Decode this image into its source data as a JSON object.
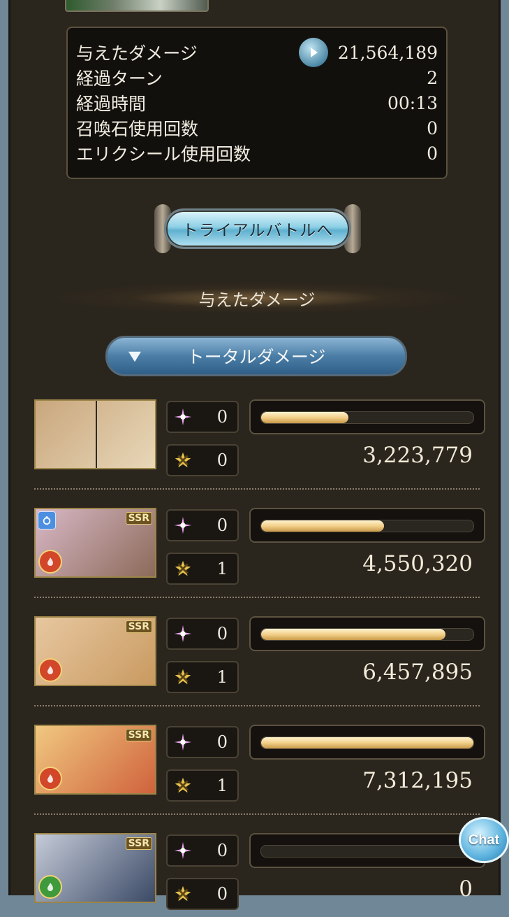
{
  "stats": {
    "rows": [
      {
        "label": "与えたダメージ",
        "value": "21,564,189"
      },
      {
        "label": "経過ターン",
        "value": "2"
      },
      {
        "label": "経過時間",
        "value": "00:13"
      },
      {
        "label": "召喚石使用回数",
        "value": "0"
      },
      {
        "label": "エリクシール使用回数",
        "value": "0"
      }
    ]
  },
  "trial_button": {
    "label": "トライアルバトルへ"
  },
  "section": {
    "title": "与えたダメージ"
  },
  "damage_select": {
    "label": "トータルダメージ"
  },
  "members": [
    {
      "ability_count": "0",
      "ca_count": "0",
      "bar_fraction": 0.41,
      "damage": "3,223,779",
      "ssr": "",
      "element": "",
      "portrait_colors": [
        "#c9a77d",
        "#e8d7b8"
      ]
    },
    {
      "ability_count": "0",
      "ca_count": "1",
      "bar_fraction": 0.58,
      "damage": "4,550,320",
      "ssr": "SSR",
      "element": "fire",
      "portrait_colors": [
        "#d8b8c6",
        "#8c6a5a"
      ]
    },
    {
      "ability_count": "0",
      "ca_count": "1",
      "bar_fraction": 0.87,
      "damage": "6,457,895",
      "ssr": "SSR",
      "element": "fire",
      "portrait_colors": [
        "#e7c7a0",
        "#c99a60"
      ]
    },
    {
      "ability_count": "0",
      "ca_count": "1",
      "bar_fraction": 1.0,
      "damage": "7,312,195",
      "ssr": "SSR",
      "element": "fire",
      "portrait_colors": [
        "#f0c880",
        "#d0623c"
      ]
    },
    {
      "ability_count": "0",
      "ca_count": "0",
      "bar_fraction": 0.0,
      "damage": "0",
      "ssr": "SSR",
      "element": "wind",
      "portrait_colors": [
        "#c5cbd8",
        "#3b4a66"
      ]
    }
  ],
  "chat_button": {
    "label": "Chat"
  },
  "colors": {
    "accent_gold": "#f2d08a",
    "panel": "#2a251d",
    "fire": "#d2462a",
    "wind": "#3e9a3a"
  }
}
